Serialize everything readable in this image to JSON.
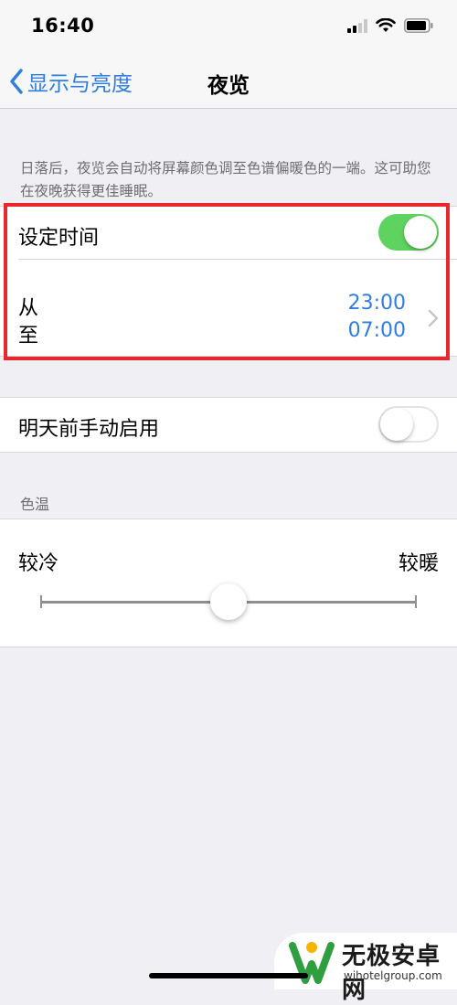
{
  "status_bar": {
    "time": "16:40"
  },
  "nav": {
    "back_label": "显示与亮度",
    "title": "夜览"
  },
  "description": "日落后，夜览会自动将屏幕颜色调至色谱偏暖色的一端。这可助您在夜晚获得更佳睡眠。",
  "schedule": {
    "label": "设定时间",
    "enabled": true,
    "from_label": "从",
    "to_label": "至",
    "from_time": "23:00",
    "to_time": "07:00"
  },
  "manual": {
    "label": "明天前手动启用",
    "enabled": false
  },
  "color_temperature": {
    "header": "色温",
    "cooler_label": "较冷",
    "warmer_label": "较暖",
    "slider_value": 0.5
  },
  "watermark": {
    "name": "无极安卓网",
    "url": "wjhotelgroup.com"
  },
  "colors": {
    "accent": "#2f7de1",
    "toggle_on": "#5fd35f",
    "highlight": "#e8282a",
    "background": "#efeff4"
  }
}
